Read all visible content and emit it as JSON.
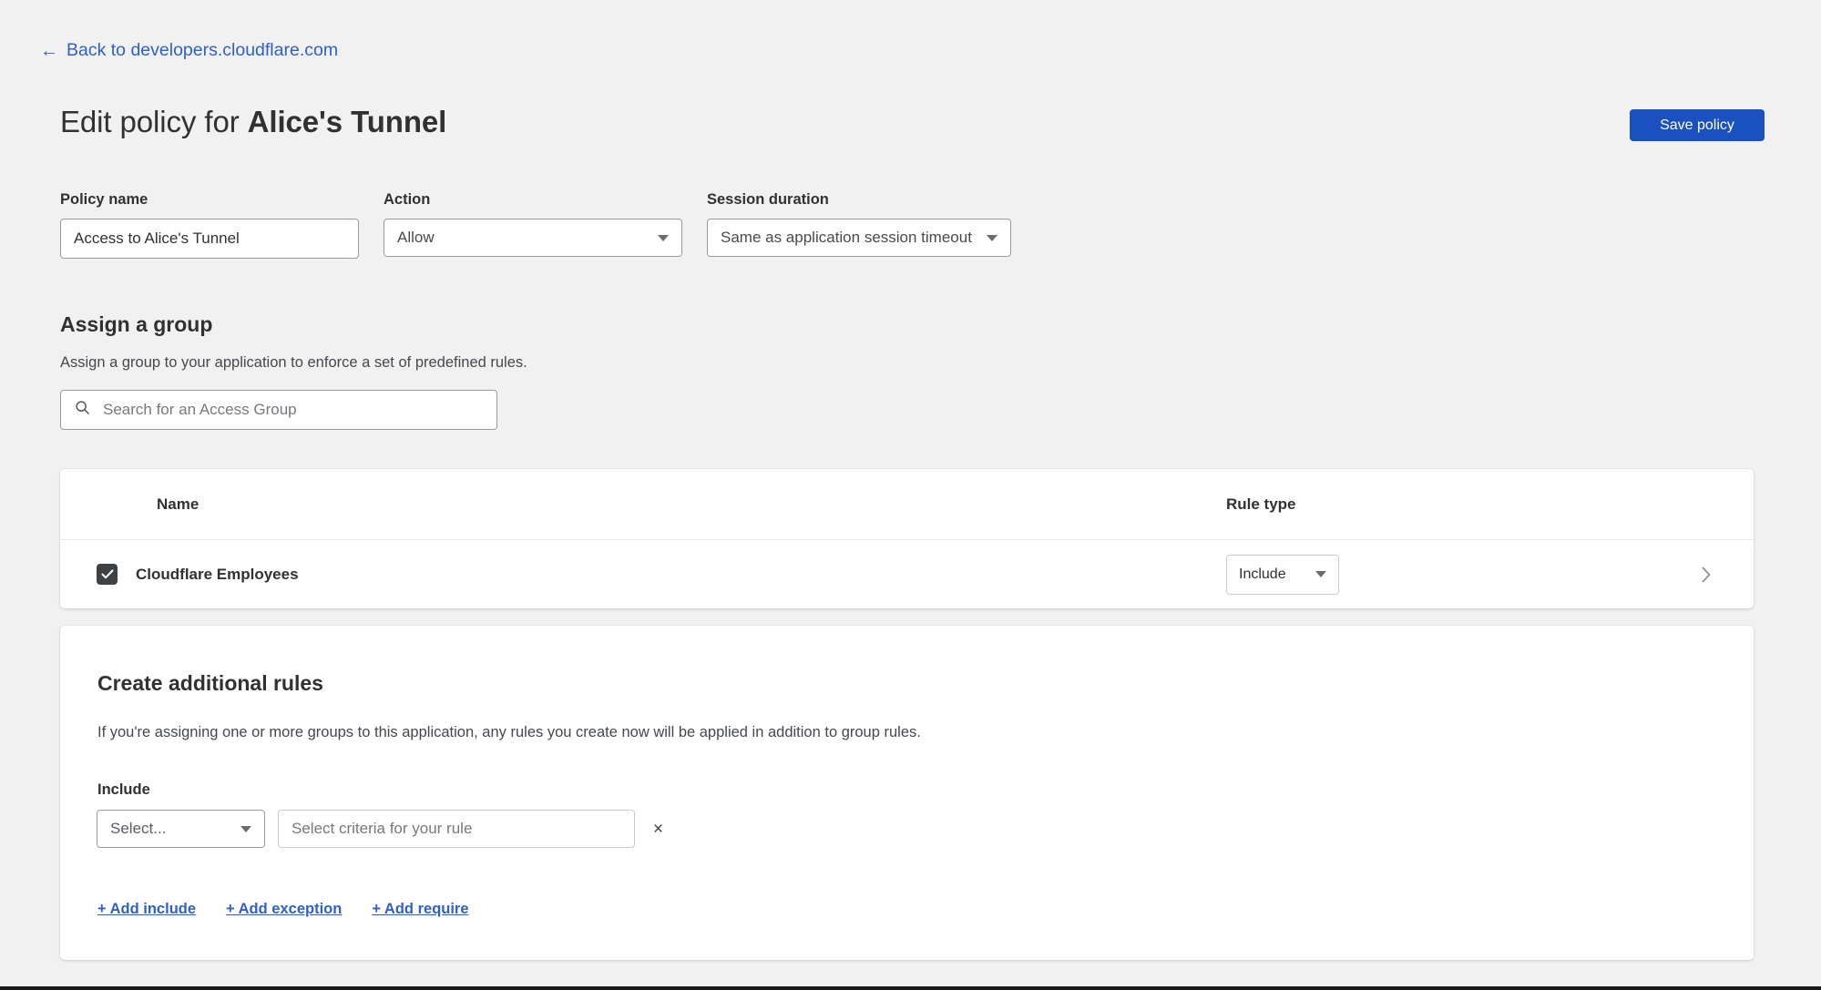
{
  "back_link": {
    "label": "Back to developers.cloudflare.com",
    "icon": "arrow-left-icon"
  },
  "header": {
    "title_prefix": "Edit policy for ",
    "title_app": "Alice's Tunnel",
    "save_label": "Save policy",
    "accent_color": "#1a50c0"
  },
  "fields": {
    "policy_name": {
      "label": "Policy name",
      "value": "Access to Alice's Tunnel",
      "placeholder": "Policy name"
    },
    "action": {
      "label": "Action",
      "value": "Allow"
    },
    "session_duration": {
      "label": "Session duration",
      "value": "Same as application session timeout"
    }
  },
  "assign_group": {
    "title": "Assign a group",
    "description": "Assign a group to your application to enforce a set of predefined rules.",
    "search_placeholder": "Search for an Access Group",
    "search_value": "",
    "search_icon": "search-icon",
    "table": {
      "columns": [
        "Name",
        "Rule type"
      ],
      "rows": [
        {
          "checked": true,
          "name": "Cloudflare Employees",
          "rule_type": "Include",
          "chevron": "chevron-right-icon"
        }
      ]
    }
  },
  "additional_rules": {
    "title": "Create additional rules",
    "description": "If you're assigning one or more groups to this application, any rules you create now will be applied in addition to group rules.",
    "include_label": "Include",
    "selector_value": "Select...",
    "criteria_placeholder": "Select criteria for your rule",
    "criteria_value": "",
    "remove_label": "×",
    "links": [
      "+ Add include",
      "+ Add exception",
      "+ Add require"
    ]
  }
}
